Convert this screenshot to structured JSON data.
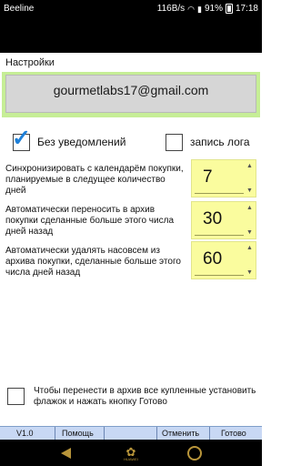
{
  "status_bar": {
    "carrier": "Beeline",
    "network_speed": "116B/s",
    "battery": "91%",
    "time": "17:18"
  },
  "settings": {
    "title": "Настройки",
    "account_email": "gourmetlabs17@gmail.com",
    "no_notifications": {
      "label": "Без уведомлений",
      "checked": true
    },
    "log_recording": {
      "label": "запись лога",
      "checked": false
    },
    "sync_calendar": {
      "label": "Синхронизировать с календарём покупки, планируемые в следущее количество дней",
      "value": "7"
    },
    "auto_archive": {
      "label": "Автоматически переносить в архив покупки сделанные больше этого числа дней назад",
      "value": "30"
    },
    "auto_delete": {
      "label": "Автоматически удалять насовсем из архива покупки, сделанные больше этого числа дней назад",
      "value": "60"
    },
    "archive_hint": {
      "label": "Чтобы перенести в архив все купленные установить флажок и нажать кнопку Готово",
      "checked": false
    }
  },
  "bottom_bar": {
    "version": "V1.0",
    "help": "Помощь",
    "cancel": "Отменить",
    "done": "Готово"
  },
  "nav_bar": {
    "brand": "HUAWEI"
  },
  "colors": {
    "account_frame": "#c6ee96",
    "stepper_bg": "#fafc9e",
    "bottom_bar_bg": "#c8d8f4",
    "checkmark": "#1d7fd8",
    "nav_icons": "#b8953a"
  }
}
